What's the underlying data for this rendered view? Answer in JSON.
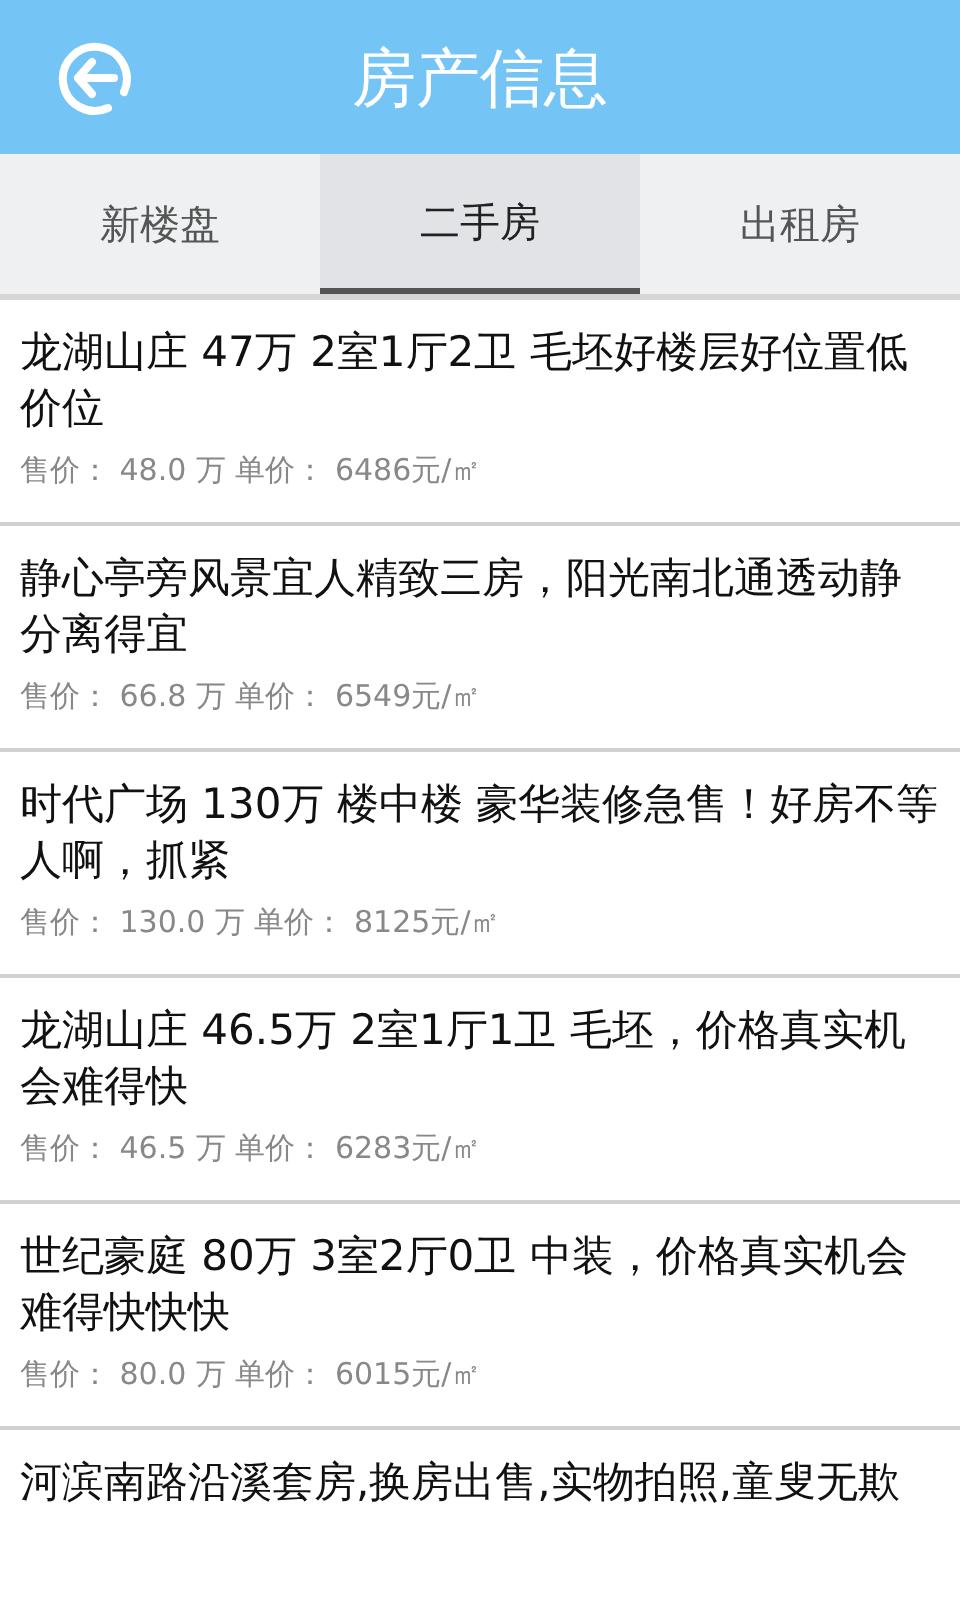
{
  "header": {
    "title": "房产信息"
  },
  "tabs": [
    {
      "label": "新楼盘",
      "selected": false
    },
    {
      "label": "二手房",
      "selected": true
    },
    {
      "label": "出租房",
      "selected": false
    }
  ],
  "listings": [
    {
      "title": "龙湖山庄 47万 2室1厅2卫 毛坯好楼层好位置低价位",
      "price": "售价： 48.0 万 单价： 6486元/㎡"
    },
    {
      "title": "静心亭旁风景宜人精致三房，阳光南北通透动静分离得宜",
      "price": "售价： 66.8 万 单价： 6549元/㎡"
    },
    {
      "title": "时代广场 130万 楼中楼 豪华装修急售！好房不等人啊，抓紧",
      "price": "售价： 130.0 万 单价： 8125元/㎡"
    },
    {
      "title": "龙湖山庄 46.5万 2室1厅1卫 毛坯，价格真实机会难得快",
      "price": "售价： 46.5 万 单价： 6283元/㎡"
    },
    {
      "title": "世纪豪庭 80万 3室2厅0卫 中装，价格真实机会难得快快快",
      "price": "售价： 80.0 万 单价： 6015元/㎡"
    },
    {
      "title": "河滨南路沿溪套房,换房出售,实物拍照,童叟无欺"
    }
  ]
}
